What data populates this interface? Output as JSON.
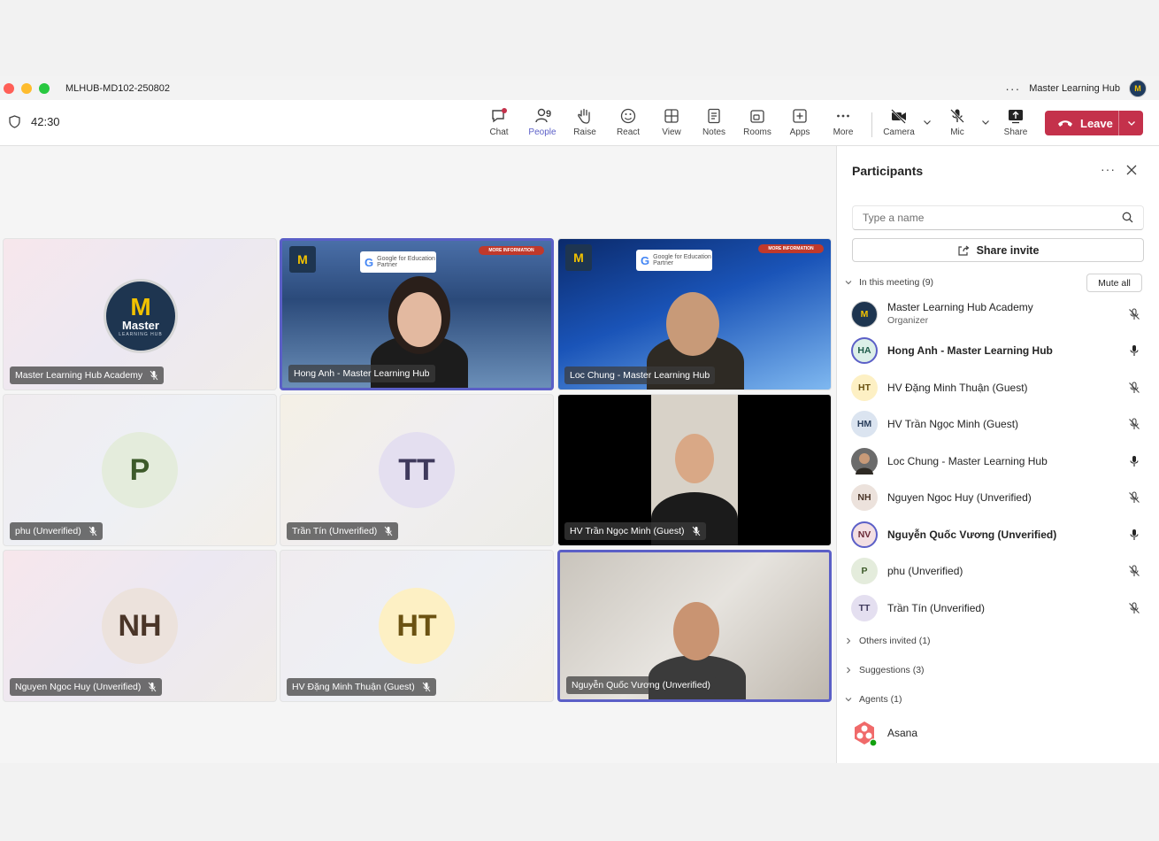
{
  "window": {
    "title": "MLHUB-MD102-250802",
    "account": "Master Learning Hub",
    "more": "···"
  },
  "timer": "42:30",
  "toolbar": {
    "chat": "Chat",
    "people": "People",
    "people_count": "9",
    "raise": "Raise",
    "react": "React",
    "view": "View",
    "notes": "Notes",
    "rooms": "Rooms",
    "apps": "Apps",
    "more": "More",
    "camera": "Camera",
    "mic": "Mic",
    "share": "Share",
    "leave": "Leave"
  },
  "tiles": [
    {
      "name": "Master Learning Hub Academy"
    },
    {
      "name": "Hong Anh - Master Learning Hub"
    },
    {
      "name": "Loc Chung - Master Learning Hub"
    },
    {
      "name": "phu (Unverified)",
      "initials": "P"
    },
    {
      "name": "Trần Tín (Unverified)",
      "initials": "TT"
    },
    {
      "name": "HV Trần Ngọc Minh (Guest)"
    },
    {
      "name": "Nguyen Ngoc Huy (Unverified)",
      "initials": "NH"
    },
    {
      "name": "HV Đặng Minh Thuận (Guest)",
      "initials": "HT"
    },
    {
      "name": "Nguyễn Quốc Vương (Unverified)"
    }
  ],
  "logo": {
    "mark": "M",
    "text": "Master",
    "sub": "LEARNING HUB"
  },
  "video_overlay": {
    "brand": "M",
    "google": "G",
    "partner_line1": "Google for Education",
    "partner_line2": "Partner",
    "more_info": "MORE INFORMATION"
  },
  "panel": {
    "title": "Participants",
    "more": "···",
    "search_placeholder": "Type a name",
    "share_invite": "Share invite",
    "in_meeting": "In this meeting (9)",
    "mute_all": "Mute all",
    "others_invited": "Others invited (1)",
    "suggestions": "Suggestions (3)",
    "agents": "Agents (1)",
    "participants": [
      {
        "name": "Master Learning Hub Academy",
        "role": "Organizer",
        "initials": "M"
      },
      {
        "name": "Hong Anh - Master Learning Hub",
        "initials": "HA"
      },
      {
        "name": "HV Đặng Minh Thuận (Guest)",
        "initials": "HT"
      },
      {
        "name": "HV Trần Ngọc Minh (Guest)",
        "initials": "HM"
      },
      {
        "name": "Loc Chung - Master Learning Hub",
        "initials": ""
      },
      {
        "name": "Nguyen Ngoc Huy (Unverified)",
        "initials": "NH"
      },
      {
        "name": "Nguyễn Quốc Vương (Unverified)",
        "initials": "NV"
      },
      {
        "name": "phu (Unverified)",
        "initials": "P"
      },
      {
        "name": "Trần Tín (Unverified)",
        "initials": "TT"
      }
    ],
    "agent_items": [
      {
        "name": "Asana"
      }
    ]
  },
  "colors": {
    "accent": "#5b5fc7",
    "leave": "#c4314b"
  }
}
